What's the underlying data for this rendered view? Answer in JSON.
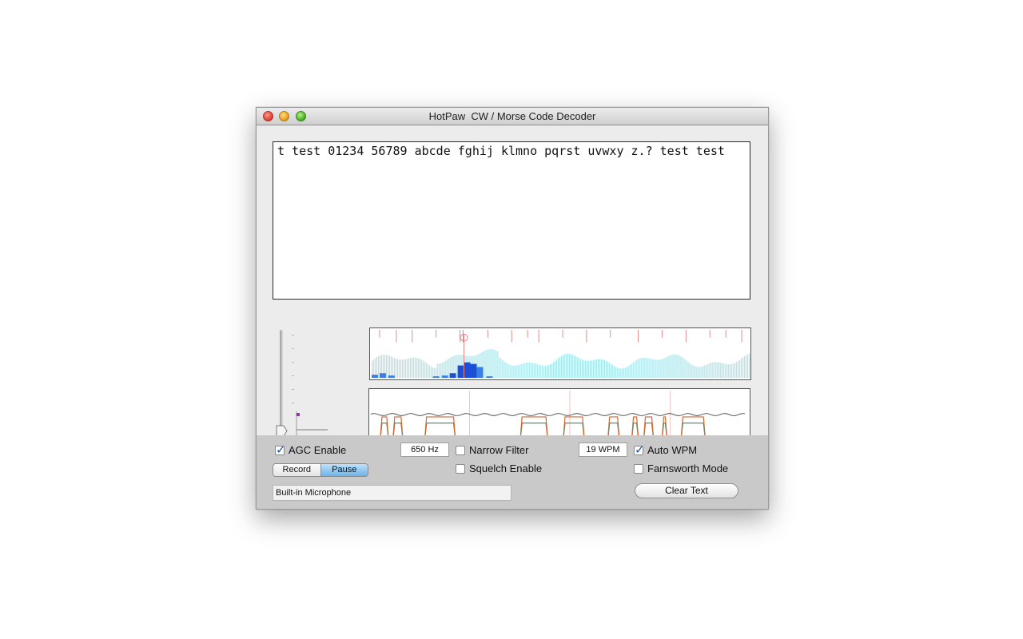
{
  "window": {
    "title": "HotPaw  CW / Morse Code Decoder"
  },
  "decoded_text": "t test 01234 56789 abcde fghij klmno pqrst uvwxy z.? test test",
  "controls": {
    "agc": {
      "label": "AGC Enable",
      "checked": true
    },
    "record_label": "Record",
    "pause_label": "Pause",
    "pause_selected": true,
    "frequency_value": "650 Hz",
    "narrow_filter": {
      "label": "Narrow Filter",
      "checked": false
    },
    "squelch": {
      "label": "Squelch Enable",
      "checked": false
    },
    "wpm_value": "19 WPM",
    "auto_wpm": {
      "label": "Auto WPM",
      "checked": true
    },
    "farnsworth": {
      "label": "Farnsworth Mode",
      "checked": false
    },
    "clear_text_label": "Clear Text",
    "input_device": "Built-in Microphone"
  },
  "colors": {
    "spectrum_bar": "#a9e7ec",
    "spectrum_peak": "#1a4fd6",
    "marker": "#e58a8a",
    "signal_orange": "#e0632a",
    "signal_green": "#3a8a5a",
    "noise_gray": "#555555"
  }
}
